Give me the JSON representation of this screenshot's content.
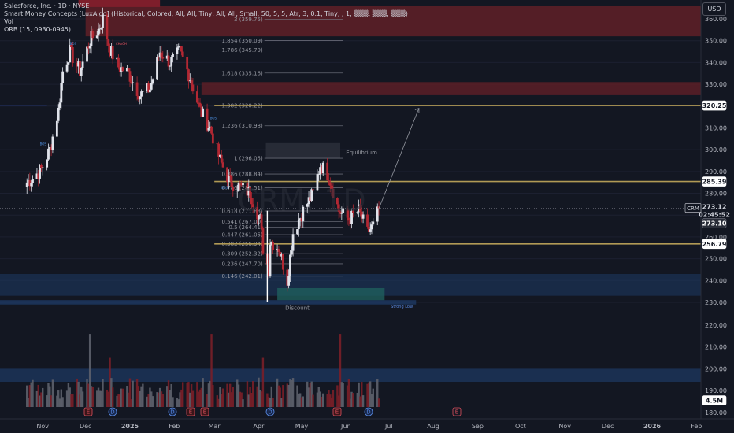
{
  "header": {
    "symbol_line": "Salesforce, Inc. · 1D · NYSE",
    "indicator_smc": "Smart Money Concepts [LuxAlgo] (Historical, Colored, All, All, Tiny, All, All, Small, 50, 5, 5, Atr, 3, 0.1, Tiny, , 1, ▒▒▒, ▒▒▒, ▒▒▒)",
    "indicator_vol": "Vol",
    "indicator_orb": "ORB (15, 0930-0945)"
  },
  "currency_button": "USD",
  "price_axis": {
    "ticks": [
      "360.00",
      "350.00",
      "340.00",
      "330.00",
      "320.00",
      "310.00",
      "300.00",
      "290.00",
      "280.00",
      "270.00",
      "260.00",
      "250.00",
      "240.00",
      "230.00"
    ],
    "volume_ticks": [
      "220.00",
      "210.00",
      "200.00",
      "190.00",
      "180.00"
    ]
  },
  "time_axis": {
    "labels": [
      "Nov",
      "Dec",
      "2025",
      "Feb",
      "Mar",
      "Apr",
      "May",
      "Jun",
      "Jul",
      "Aug",
      "Sep",
      "Oct",
      "Nov",
      "Dec",
      "2026",
      "Feb"
    ],
    "bold": [
      "2025",
      "2026"
    ]
  },
  "fib_levels": [
    {
      "label": "2 (359.75)"
    },
    {
      "label": "1.854 (350.09)"
    },
    {
      "label": "1.786 (345.79)"
    },
    {
      "label": "1.618 (335.16)"
    },
    {
      "label": "1.382 (320.22)"
    },
    {
      "label": "1.236 (310.98)"
    },
    {
      "label": "1 (296.05)"
    },
    {
      "label": "0.886 (288.84)"
    },
    {
      "label": "0.786 (282.51)"
    },
    {
      "label": "0.618 (271.88)"
    },
    {
      "label": "0.541 (267.00)"
    },
    {
      "label": "0.5 (264.41)"
    },
    {
      "label": "0.447 (261.05)"
    },
    {
      "label": "0.382 (256.94)"
    },
    {
      "label": "0.309 (252.32)"
    },
    {
      "label": "0.236 (247.70)"
    },
    {
      "label": "0.146 (242.01)"
    }
  ],
  "price_tags": [
    {
      "text": "320.25",
      "kind": "level"
    },
    {
      "text": "285.39",
      "kind": "level"
    },
    {
      "text": "256.79",
      "kind": "level"
    },
    {
      "text": "273.12",
      "kind": "last"
    },
    {
      "text": "02:45:52",
      "kind": "countdown"
    },
    {
      "text": "273.10",
      "kind": "current"
    },
    {
      "text": "4.5M",
      "kind": "volume"
    }
  ],
  "symbol_tag": "CRM",
  "annotations": {
    "equilibrium": "Equilibrium",
    "discount": "Discount",
    "strong_low": "Strong Low",
    "bos": "BOS",
    "choch": "CHoCH",
    "watermark": "CRM, 1D"
  },
  "event_markers": [
    {
      "letter": "E"
    },
    {
      "letter": "D"
    },
    {
      "letter": "E"
    },
    {
      "letter": "D"
    },
    {
      "letter": "E"
    },
    {
      "letter": "D"
    },
    {
      "letter": "E"
    },
    {
      "letter": "D"
    },
    {
      "letter": "E"
    }
  ],
  "colors": {
    "background": "#131722",
    "bull_candle": "#e0e3eb",
    "bear_candle": "#b22833",
    "premium_zone": "#5c1f27",
    "discount_zone": "#1e3a64",
    "level_line": "#b19a55",
    "text": "#b2b5be"
  },
  "chart_data": {
    "type": "candlestick",
    "title": "Salesforce, Inc. · 1D · NYSE",
    "ylim": [
      228,
      366
    ],
    "last_price": 273.12,
    "horizontal_levels": [
      320.25,
      285.39,
      256.79
    ],
    "swing_high": 369.0,
    "swing_low": 230.0,
    "close_path": [
      {
        "date": "2024-10-21",
        "close": 285
      },
      {
        "date": "2024-10-25",
        "close": 287
      },
      {
        "date": "2024-10-31",
        "close": 291
      },
      {
        "date": "2024-11-06",
        "close": 300
      },
      {
        "date": "2024-11-12",
        "close": 318
      },
      {
        "date": "2024-11-15",
        "close": 336
      },
      {
        "date": "2024-11-20",
        "close": 345
      },
      {
        "date": "2024-11-27",
        "close": 336
      },
      {
        "date": "2024-12-04",
        "close": 350
      },
      {
        "date": "2024-12-10",
        "close": 355
      },
      {
        "date": "2024-12-13",
        "close": 360
      },
      {
        "date": "2024-12-18",
        "close": 346
      },
      {
        "date": "2024-12-24",
        "close": 338
      },
      {
        "date": "2024-12-31",
        "close": 335
      },
      {
        "date": "2025-01-08",
        "close": 325
      },
      {
        "date": "2025-01-15",
        "close": 328
      },
      {
        "date": "2025-01-22",
        "close": 345
      },
      {
        "date": "2025-01-29",
        "close": 340
      },
      {
        "date": "2025-02-05",
        "close": 345
      },
      {
        "date": "2025-02-12",
        "close": 333
      },
      {
        "date": "2025-02-19",
        "close": 318
      },
      {
        "date": "2025-02-26",
        "close": 310
      },
      {
        "date": "2025-03-05",
        "close": 295
      },
      {
        "date": "2025-03-12",
        "close": 285
      },
      {
        "date": "2025-03-19",
        "close": 283
      },
      {
        "date": "2025-03-26",
        "close": 280
      },
      {
        "date": "2025-04-02",
        "close": 268
      },
      {
        "date": "2025-04-04",
        "close": 255
      },
      {
        "date": "2025-04-08",
        "close": 245
      },
      {
        "date": "2025-04-09",
        "close": 258
      },
      {
        "date": "2025-04-15",
        "close": 255
      },
      {
        "date": "2025-04-21",
        "close": 240
      },
      {
        "date": "2025-04-25",
        "close": 262
      },
      {
        "date": "2025-05-02",
        "close": 272
      },
      {
        "date": "2025-05-09",
        "close": 280
      },
      {
        "date": "2025-05-14",
        "close": 293
      },
      {
        "date": "2025-05-20",
        "close": 288
      },
      {
        "date": "2025-05-27",
        "close": 272
      },
      {
        "date": "2025-06-03",
        "close": 268
      },
      {
        "date": "2025-06-10",
        "close": 272
      },
      {
        "date": "2025-06-16",
        "close": 262
      },
      {
        "date": "2025-06-20",
        "close": 265
      },
      {
        "date": "2025-06-24",
        "close": 273
      }
    ],
    "zones": [
      {
        "name": "premium_top",
        "from": 352,
        "to": 366
      },
      {
        "name": "supply",
        "from": 325,
        "to": 331
      },
      {
        "name": "equilibrium",
        "from": 296,
        "to": 303
      },
      {
        "name": "discount",
        "from": 233,
        "to": 243
      },
      {
        "name": "strong_low",
        "from": 229,
        "to": 231
      }
    ],
    "projection": {
      "from_date": "2025-06-24",
      "from_price": 273,
      "to_date": "2025-07-22",
      "to_price": 319
    }
  }
}
